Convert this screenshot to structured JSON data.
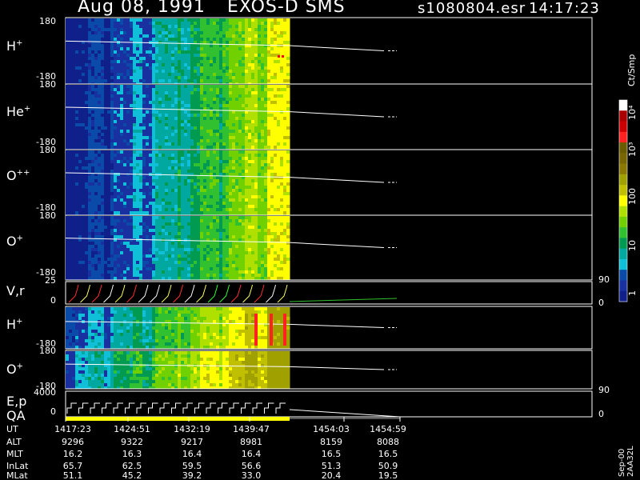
{
  "header": {
    "date": "Aug 08, 1991",
    "instrument": "EXOS-D SMS",
    "file": "s1080804.esr",
    "time": "14:17:23"
  },
  "panels": [
    {
      "label": "H",
      "sup": "+",
      "ymax": "180",
      "ymin": "-180"
    },
    {
      "label": "He",
      "sup": "+",
      "ymax": "180",
      "ymin": "-180"
    },
    {
      "label": "O",
      "sup": "++",
      "ymax": "180",
      "ymin": "-180"
    },
    {
      "label": "O",
      "sup": "+",
      "ymax": "180",
      "ymin": "-180"
    },
    {
      "label": "V,r",
      "sup": "",
      "ymax": "25",
      "ymin": "0",
      "rmax": "90",
      "rmin": "0"
    },
    {
      "label": "H",
      "sup": "+",
      "ymax": "",
      "ymin": "-180"
    },
    {
      "label": "O",
      "sup": "+",
      "ymax": "180",
      "ymin": "-180"
    },
    {
      "label": "E,p",
      "sup": "",
      "ymax": "4000",
      "ymin": "0",
      "rmax": "90",
      "rmin": "0"
    }
  ],
  "qa_label": "QA",
  "colorbar": {
    "unit": "Ct/Smp",
    "ticks": [
      "10⁴",
      "10³",
      "100",
      "10",
      "1"
    ],
    "colors": [
      "#ffffff",
      "#aa0000",
      "#cc0000",
      "#ff2020",
      "#6a5a00",
      "#7a6600",
      "#8a7800",
      "#a0a000",
      "#c0c000",
      "#ffff00",
      "#b0e000",
      "#70d000",
      "#30c030",
      "#009a50",
      "#00a8a0",
      "#10c0d8",
      "#0a4aa8",
      "#1830a0",
      "#10208a"
    ]
  },
  "orbit": {
    "rows": [
      {
        "name": "UT",
        "values": [
          "1417:23",
          "1424:51",
          "1432:19",
          "1439:47",
          "1454:03",
          "1454:59"
        ]
      },
      {
        "name": "ALT",
        "values": [
          "9296",
          "9322",
          "9217",
          "8981",
          "8159",
          "8088"
        ]
      },
      {
        "name": "MLT",
        "values": [
          "16.2",
          "16.3",
          "16.4",
          "16.4",
          "16.5",
          "16.5"
        ]
      },
      {
        "name": "InLat",
        "values": [
          "65.7",
          "62.5",
          "59.5",
          "56.6",
          "51.3",
          "50.9"
        ]
      },
      {
        "name": "MLat",
        "values": [
          "51.1",
          "45.2",
          "39.2",
          "33.0",
          "20.4",
          "19.5"
        ]
      }
    ]
  },
  "side_note": "Sep-00  2AA32L",
  "chart_data": {
    "type": "heatmap",
    "title": "Aug 08, 1991   EXOS-D SMS",
    "time_labels": [
      "1417:23",
      "1424:51",
      "1432:19",
      "1439:47",
      "1454:03",
      "1454:59"
    ],
    "colorbar_ticks": [
      "1",
      "10",
      "100",
      "1000",
      "10000"
    ],
    "colorbar_unit": "Ct/Smp",
    "pitch_angle_range": [
      -180,
      180
    ],
    "species": [
      "H+",
      "He+",
      "O++",
      "O+",
      "H+",
      "O+"
    ]
  }
}
